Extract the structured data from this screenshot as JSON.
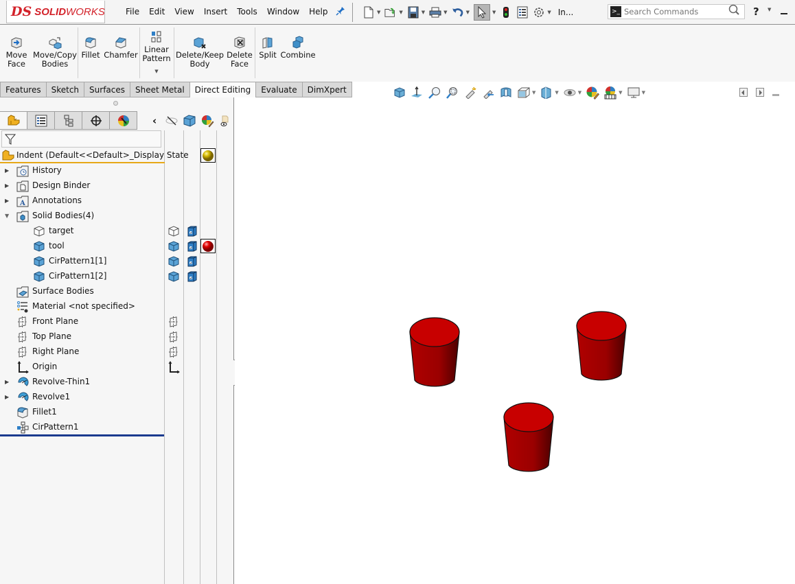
{
  "app": {
    "brand_prefix": "DS",
    "brand_bold": "SOLID",
    "brand_light": "WORKS"
  },
  "menu": [
    "File",
    "Edit",
    "View",
    "Insert",
    "Tools",
    "Window",
    "Help"
  ],
  "quick_toolbar": {
    "items": [
      "new-document-icon",
      "open-icon",
      "save-icon",
      "print-icon",
      "undo-icon",
      "select-icon",
      "rebuild-traffic-light-icon",
      "file-properties-icon",
      "options-gear-icon"
    ],
    "truncated_label": "In...",
    "search_placeholder": "Search Commands",
    "help_label": "?"
  },
  "ribbon": {
    "buttons": [
      {
        "id": "move-face",
        "label": "Move Face",
        "line1": "Move",
        "line2": "Face"
      },
      {
        "id": "move-copy-bodies",
        "label": "Move/Copy Bodies",
        "line1": "Move/Copy",
        "line2": "Bodies"
      },
      {
        "id": "fillet",
        "label": "Fillet",
        "line1": "Fillet",
        "line2": ""
      },
      {
        "id": "chamfer",
        "label": "Chamfer",
        "line1": "Chamfer",
        "line2": ""
      },
      {
        "id": "linear-pattern",
        "label": "Linear Pattern",
        "line1": "Linear",
        "line2": "Pattern"
      },
      {
        "id": "delete-keep-body",
        "label": "Delete/Keep Body",
        "line1": "Delete/Keep",
        "line2": "Body"
      },
      {
        "id": "delete-face",
        "label": "Delete Face",
        "line1": "Delete",
        "line2": "Face"
      },
      {
        "id": "split",
        "label": "Split",
        "line1": "Split",
        "line2": ""
      },
      {
        "id": "combine",
        "label": "Combine",
        "line1": "Combine",
        "line2": ""
      }
    ]
  },
  "command_tabs": [
    {
      "label": "Features",
      "active": false
    },
    {
      "label": "Sketch",
      "active": false
    },
    {
      "label": "Surfaces",
      "active": false
    },
    {
      "label": "Sheet Metal",
      "active": false
    },
    {
      "label": "Direct Editing",
      "active": true
    },
    {
      "label": "Evaluate",
      "active": false
    },
    {
      "label": "DimXpert",
      "active": false
    }
  ],
  "panel_tabs": [
    "feature-manager",
    "property-manager",
    "configuration-manager",
    "dimxpert-manager",
    "display-manager"
  ],
  "tree": {
    "root": "Indent  (Default<<Default>_Display State",
    "items": [
      {
        "label": "History",
        "icon": "history-folder-icon",
        "expandable": true,
        "expanded": false,
        "indent": 0
      },
      {
        "label": "Design Binder",
        "icon": "design-binder-folder-icon",
        "expandable": true,
        "expanded": false,
        "indent": 0
      },
      {
        "label": "Annotations",
        "icon": "annotations-folder-icon",
        "expandable": true,
        "expanded": false,
        "indent": 0
      },
      {
        "label": "Solid Bodies(4)",
        "icon": "solid-bodies-folder-icon",
        "expandable": true,
        "expanded": true,
        "indent": 0
      },
      {
        "label": "target",
        "icon": "body-hidden-icon",
        "expandable": false,
        "indent": 1
      },
      {
        "label": "tool",
        "icon": "body-icon",
        "expandable": false,
        "indent": 1
      },
      {
        "label": "CirPattern1[1]",
        "icon": "body-icon",
        "expandable": false,
        "indent": 1
      },
      {
        "label": "CirPattern1[2]",
        "icon": "body-icon",
        "expandable": false,
        "indent": 1
      },
      {
        "label": "Surface Bodies",
        "icon": "surface-bodies-folder-icon",
        "expandable": false,
        "indent": 0
      },
      {
        "label": "Material <not specified>",
        "icon": "material-icon",
        "expandable": false,
        "indent": 0
      },
      {
        "label": "Front Plane",
        "icon": "plane-icon",
        "expandable": false,
        "indent": 0
      },
      {
        "label": "Top Plane",
        "icon": "plane-icon",
        "expandable": false,
        "indent": 0
      },
      {
        "label": "Right Plane",
        "icon": "plane-icon",
        "expandable": false,
        "indent": 0
      },
      {
        "label": "Origin",
        "icon": "origin-icon",
        "expandable": false,
        "indent": 0
      },
      {
        "label": "Revolve-Thin1",
        "icon": "revolve-icon",
        "expandable": true,
        "expanded": false,
        "indent": 0
      },
      {
        "label": "Revolve1",
        "icon": "revolve-icon",
        "expandable": true,
        "expanded": false,
        "indent": 0
      },
      {
        "label": "Fillet1",
        "icon": "fillet-feature-icon",
        "expandable": false,
        "indent": 0
      },
      {
        "label": "CirPattern1",
        "icon": "circular-pattern-icon",
        "expandable": false,
        "indent": 0
      }
    ]
  },
  "display_columns": {
    "appearance_root_color": "#d4b800",
    "appearance_tool_color": "#e00000"
  },
  "viewport": {
    "body_color": "#c80000",
    "bodies": [
      "cylinder-1",
      "cylinder-2",
      "cylinder-3"
    ]
  }
}
